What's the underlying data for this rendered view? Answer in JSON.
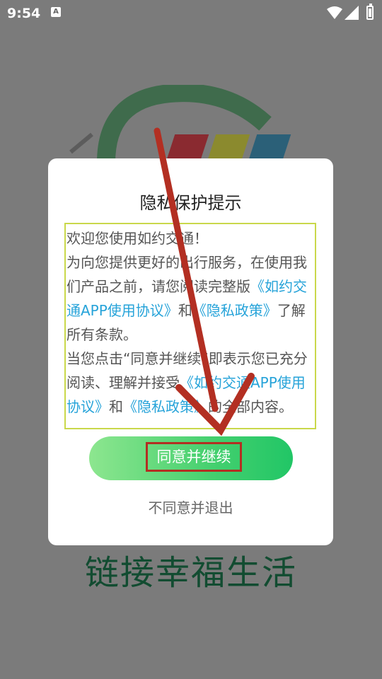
{
  "status_bar": {
    "time": "9:54",
    "notification_icon": "font-a-icon"
  },
  "background": {
    "slogan": "链接幸福生活"
  },
  "dialog": {
    "title": "隐私保护提示",
    "body": {
      "p1": "欢迎您使用如约交通！",
      "p2_a": "为向您提供更好的出行服务，在使用我们产品之前，请您阅读完整版",
      "p2_link1": "《如约交通APP使用协议》",
      "p2_b": "和",
      "p2_link2": "《隐私政策》",
      "p2_c": "了解所有条款。",
      "p3_a": "当您点击“同意并继续”即表示您已充分阅读、理解并接受",
      "p3_link1": "《如约交通APP使用协议》",
      "p3_b": "和",
      "p3_link2": "《隐私政策》",
      "p3_c": "的全部内容。"
    },
    "agree_label": "同意并继续",
    "disagree_label": "不同意并退出"
  },
  "colors": {
    "link": "#26a3d9",
    "button_gradient_start": "#8de68f",
    "button_gradient_end": "#21c666",
    "highlight_box": "#b32f22",
    "content_border": "#c9d84a",
    "slogan": "#124c31"
  }
}
